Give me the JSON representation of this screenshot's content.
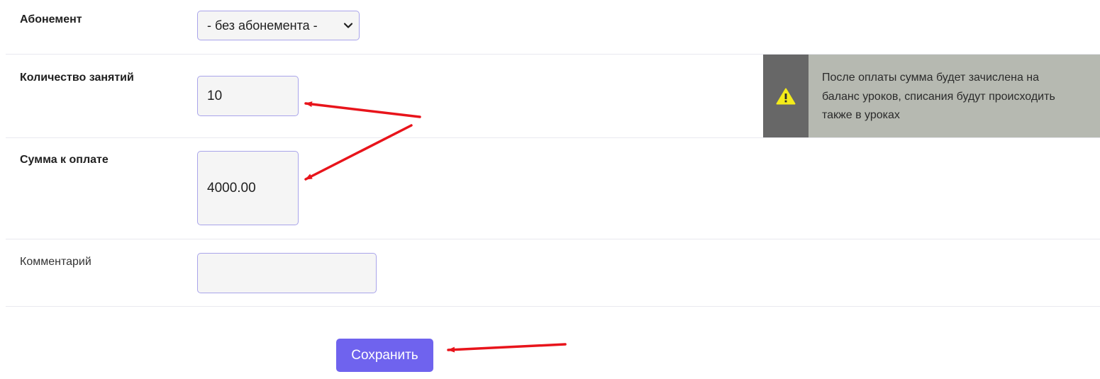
{
  "form": {
    "subscription": {
      "label": "Абонемент",
      "selected": "- без абонемента -"
    },
    "lessons_count": {
      "label": "Количество занятий",
      "value": "10"
    },
    "amount": {
      "label": "Сумма к оплате",
      "value": "4000.00"
    },
    "comment": {
      "label": "Комментарий",
      "value": ""
    },
    "save_label": "Сохранить"
  },
  "notice": {
    "icon": "warning-icon",
    "lines": [
      "После оплаты сумма будет зачислена на",
      "баланс уроков, списания будут происходить",
      "также в уроках"
    ]
  },
  "colors": {
    "accent": "#6f63ee",
    "input_border": "#a9a4ea",
    "notice_icon_bg": "#676767",
    "notice_bg": "#b6b9b1",
    "annotation_arrow": "#e8141b",
    "warning": "#f4ec1a"
  }
}
